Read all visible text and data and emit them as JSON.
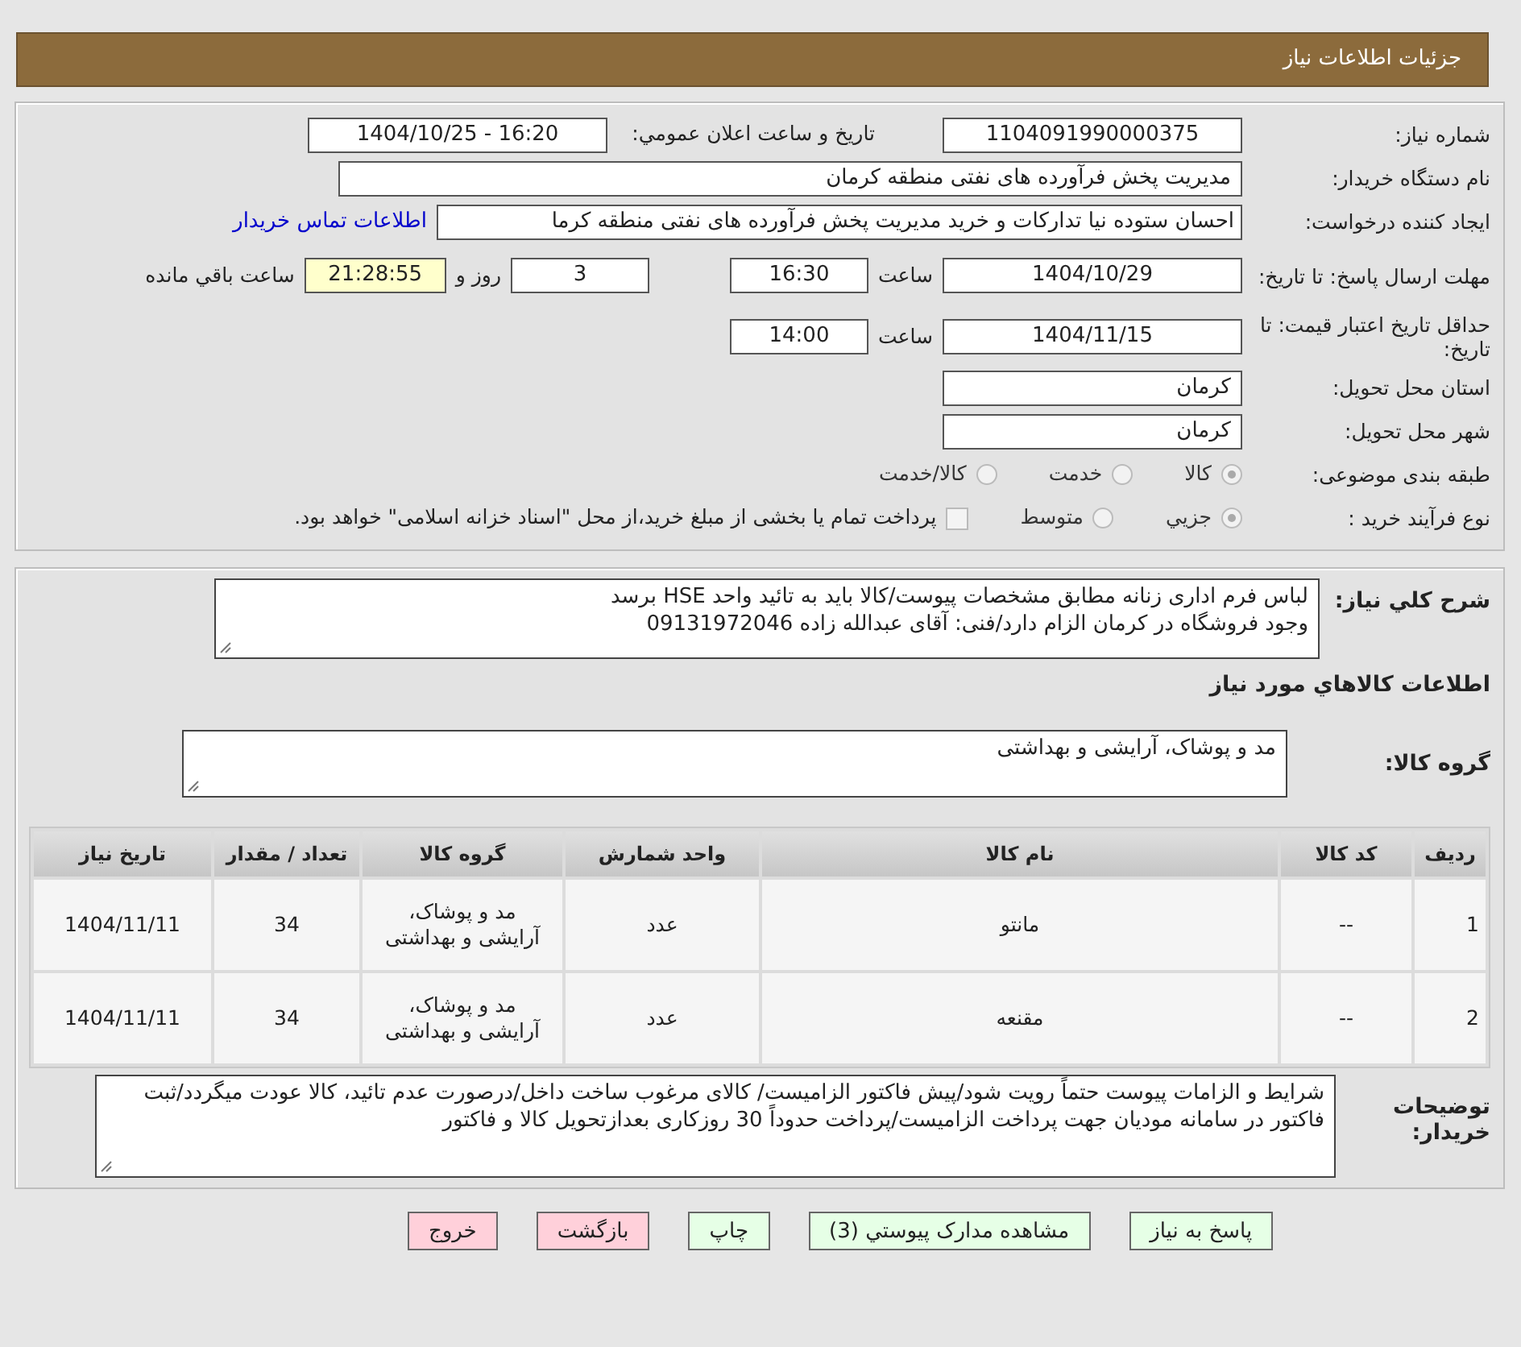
{
  "header": {
    "title": "جزئیات اطلاعات نیاز"
  },
  "details": {
    "need_number": {
      "label": "شماره نیاز:",
      "value": "1104091990000375"
    },
    "announce": {
      "label": "تاریخ و ساعت اعلان عمومي:",
      "value": "1404/10/25 - 16:20"
    },
    "buyer": {
      "label": "نام دستگاه خریدار:",
      "value": "مدیریت پخش فرآورده های نفتی منطقه کرمان"
    },
    "creator": {
      "label": "ایجاد کننده درخواست:",
      "value": "احسان  ستوده نیا  تدارکات و خرید  مدیریت پخش فرآورده های نفتی منطقه کرما",
      "link": "اطلاعات تماس خريدار"
    },
    "deadline": {
      "label": "مهلت ارسال پاسخ: تا تاریخ:",
      "date": "1404/10/29",
      "time_label": "ساعت",
      "time": "16:30",
      "days": "3",
      "days_label": "روز و",
      "remaining": "21:28:55",
      "remaining_label": "ساعت باقي مانده"
    },
    "validity": {
      "label": "حداقل تاریخ اعتبار قیمت: تا تاریخ:",
      "date": "1404/11/15",
      "time_label": "ساعت",
      "time": "14:00"
    },
    "province": {
      "label": "استان محل تحویل:",
      "value": "کرمان"
    },
    "city": {
      "label": "شهر محل تحویل:",
      "value": "کرمان"
    },
    "category": {
      "label": "طبقه بندی موضوعی:",
      "options": [
        {
          "label": "کالا",
          "selected": true
        },
        {
          "label": "خدمت",
          "selected": false
        },
        {
          "label": "کالا/خدمت",
          "selected": false
        }
      ]
    },
    "process": {
      "label": "نوع فرآیند خرید :",
      "options": [
        {
          "label": "جزيي",
          "selected": true
        },
        {
          "label": "متوسط",
          "selected": false
        }
      ],
      "treasury": {
        "checked": false,
        "label": "پرداخت تمام یا بخشی از مبلغ خرید،از محل \"اسناد خزانه اسلامی\" خواهد بود."
      }
    }
  },
  "needs": {
    "description": {
      "label": "شرح کلي نیاز:",
      "lines": [
        "لباس فرم اداری زنانه مطابق مشخصات پیوست/کالا باید به تائید واحد HSE برسد",
        "وجود فروشگاه در کرمان الزام دارد/فنی: آقای عبدالله زاده 09131972046"
      ]
    },
    "goods_heading": "اطلاعات کالاهاي مورد نیاز",
    "goods_group": {
      "label": "گروه کالا:",
      "value": "مد و پوشاک، آرایشی و بهداشتی"
    },
    "table": {
      "columns": [
        "ردیف",
        "کد کالا",
        "نام کالا",
        "واحد شمارش",
        "گروه کالا",
        "تعداد / مقدار",
        "تاریخ نیاز"
      ],
      "rows": [
        [
          "1",
          "--",
          "مانتو",
          "عدد",
          "مد و پوشاک، آرایشی و بهداشتی",
          "34",
          "1404/11/11"
        ],
        [
          "2",
          "--",
          "مقنعه",
          "عدد",
          "مد و پوشاک، آرایشی و بهداشتی",
          "34",
          "1404/11/11"
        ]
      ]
    },
    "buyer_notes": {
      "label": "توضیحات خریدار:",
      "lines": [
        "شرایط و الزامات پیوست حتماً رویت شود/پیش فاکتور الزامیست/ کالای مرغوب ساخت داخل/درصورت عدم تائید، کالا عودت میگردد/ثبت فاکتور در سامانه مودیان جهت پرداخت الزامیست/پرداخت حدوداً 30 روزکاری بعدازتحویل کالا و فاکتور"
      ]
    }
  },
  "buttons": [
    {
      "label": "پاسخ به نیاز",
      "kind": "action"
    },
    {
      "label": "مشاهده مدارک پیوستي (3)",
      "kind": "action"
    },
    {
      "label": "چاپ",
      "kind": "action"
    },
    {
      "label": "بازگشت",
      "kind": "exit"
    },
    {
      "label": "خروج",
      "kind": "exit"
    }
  ]
}
